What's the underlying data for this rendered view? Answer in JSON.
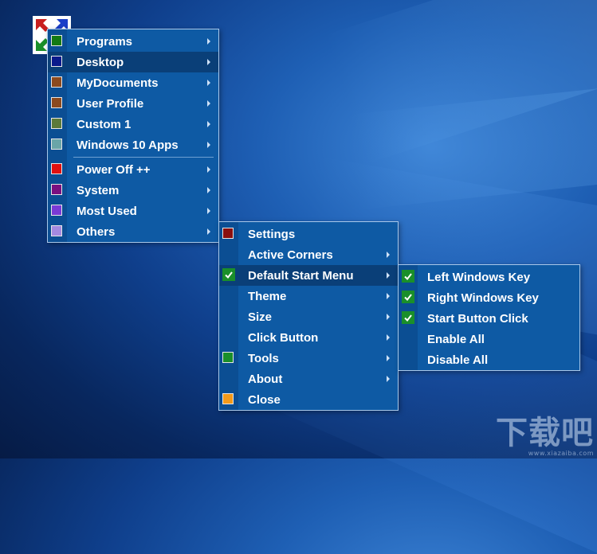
{
  "colors": {
    "menu_bg": "#0e5aa4",
    "menu_active": "#0a3f78",
    "check_green": "#1a8f2a"
  },
  "menu1": {
    "items": [
      {
        "label": "Programs",
        "icon": "green-square-icon",
        "color": "#137a13",
        "arrow": true
      },
      {
        "label": "Desktop",
        "icon": "navy-square-icon",
        "color": "#0a1a8c",
        "arrow": true,
        "active": true
      },
      {
        "label": "MyDocuments",
        "icon": "brown-square-icon",
        "color": "#8b4a1f",
        "arrow": true
      },
      {
        "label": "User Profile",
        "icon": "brown-square-icon",
        "color": "#8b4a1f",
        "arrow": true
      },
      {
        "label": "Custom 1",
        "icon": "olive-square-icon",
        "color": "#5c7a3a",
        "arrow": true
      },
      {
        "label": "Windows 10 Apps",
        "icon": "teal-square-icon",
        "color": "#6aa5a8",
        "arrow": true
      },
      {
        "label": "Power Off ++",
        "icon": "red-square-icon",
        "color": "#e01010",
        "arrow": true
      },
      {
        "label": "System",
        "icon": "purple-square-icon",
        "color": "#7a1080",
        "arrow": true
      },
      {
        "label": "Most Used",
        "icon": "violet-square-icon",
        "color": "#7a3ad6",
        "arrow": true
      },
      {
        "label": "Others",
        "icon": "lavender-square-icon",
        "color": "#a58ae0",
        "arrow": true
      }
    ]
  },
  "menu2": {
    "items": [
      {
        "label": "Settings",
        "icon": "maroon-square-icon",
        "color": "#8a0f0f",
        "arrow": false
      },
      {
        "label": "Active Corners",
        "icon": "",
        "arrow": true
      },
      {
        "label": "Default Start Menu",
        "icon": "check-icon",
        "checked": true,
        "arrow": true,
        "active": true
      },
      {
        "label": "Theme",
        "icon": "",
        "arrow": true
      },
      {
        "label": "Size",
        "icon": "",
        "arrow": true
      },
      {
        "label": "Click Button",
        "icon": "",
        "arrow": true
      },
      {
        "label": "Tools",
        "icon": "green-square-icon",
        "color": "#1a8f2a",
        "arrow": true
      },
      {
        "label": "About",
        "icon": "",
        "arrow": true
      },
      {
        "label": "Close",
        "icon": "orange-square-icon",
        "color": "#f39a1a",
        "arrow": false
      }
    ]
  },
  "menu3": {
    "items": [
      {
        "label": "Left Windows Key",
        "checked": true
      },
      {
        "label": "Right Windows Key",
        "checked": true
      },
      {
        "label": "Start Button Click",
        "checked": true
      },
      {
        "label": "Enable All",
        "checked": false
      },
      {
        "label": "Disable All",
        "checked": false
      }
    ]
  }
}
